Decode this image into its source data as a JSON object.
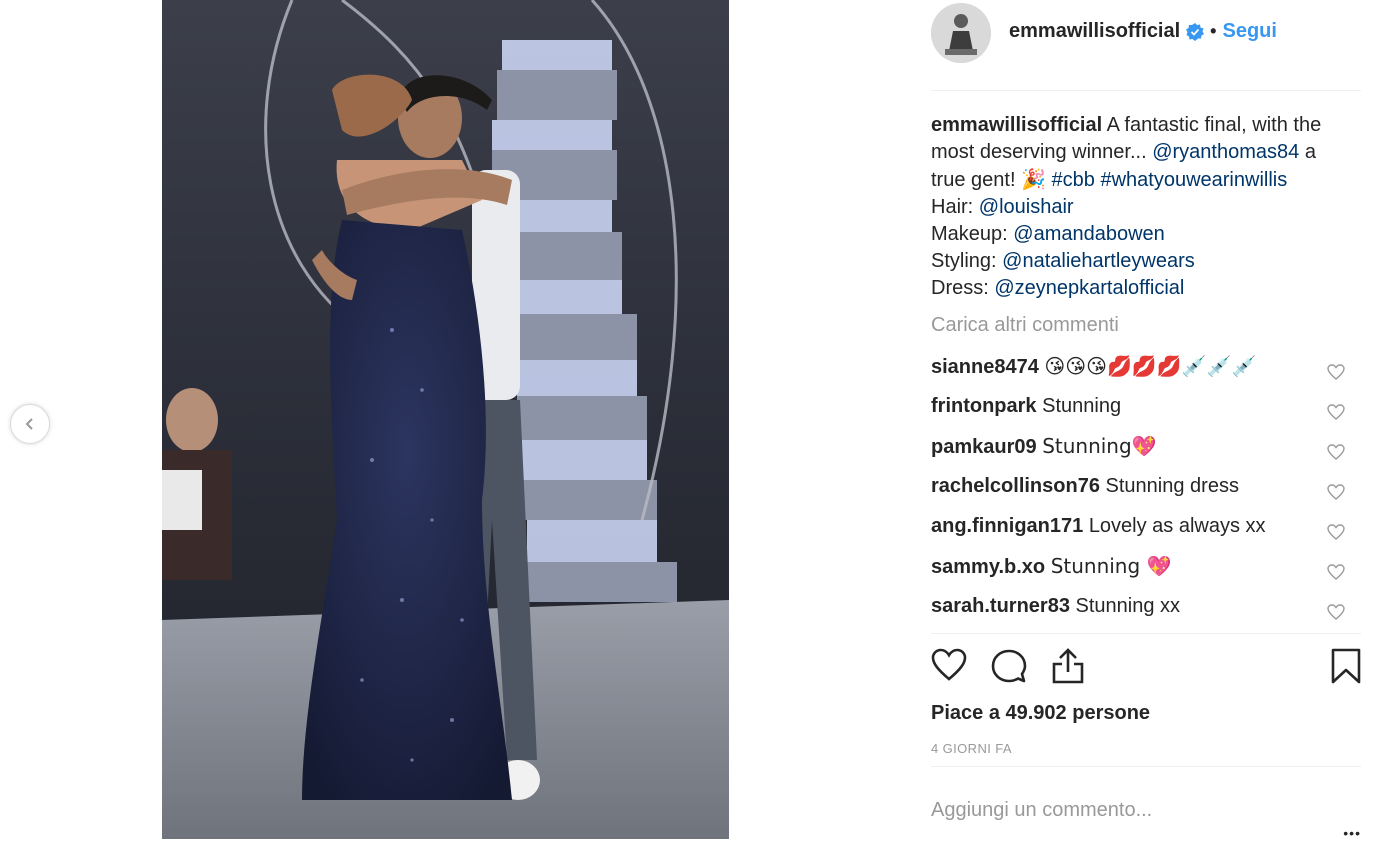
{
  "post": {
    "username": "emmawillisofficial",
    "follow_label": "Segui",
    "separator": "•",
    "verified_icon": "verified-badge-icon"
  },
  "caption": {
    "username": "emmawillisofficial",
    "text_1": "A fantastic final, with the most deserving winner... ",
    "mention_1": "@ryanthomas84",
    "text_2": " a true gent! ",
    "emoji": "🎉",
    "hashtag_1": "#cbb",
    "hashtag_2": "#whatyouwearinwillis",
    "hair_label": "Hair: ",
    "hair_mention": "@louishair",
    "makeup_label": "Makeup: ",
    "makeup_mention": "@amandabowen",
    "styling_label": "Styling: ",
    "styling_mention": "@nataliehartleywears",
    "dress_label": "Dress: ",
    "dress_mention": "@zeynepkartalofficial"
  },
  "load_more": "Carica altri commenti",
  "comments": [
    {
      "user": "sianne8474",
      "text": "😘😘😘💋💋💋💉💉💉"
    },
    {
      "user": "frintonpark",
      "text": "Stunning"
    },
    {
      "user": "pamkaur09",
      "text": "Stunning💖"
    },
    {
      "user": "rachelcollinson76",
      "text": "Stunning dress"
    },
    {
      "user": "ang.finnigan171",
      "text": "Lovely as always xx"
    },
    {
      "user": "sammy.b.xo",
      "text": "Stunning 💖"
    },
    {
      "user": "sarah.turner83",
      "text": "Stunning xx"
    }
  ],
  "likes": "Piace a 49.902 persone",
  "time_ago": "4 GIORNI FA",
  "add_comment_placeholder": "Aggiungi un commento...",
  "more_options": "•••",
  "colors": {
    "link": "#003569",
    "follow": "#3897f0",
    "muted": "#999999",
    "text": "#262626"
  }
}
